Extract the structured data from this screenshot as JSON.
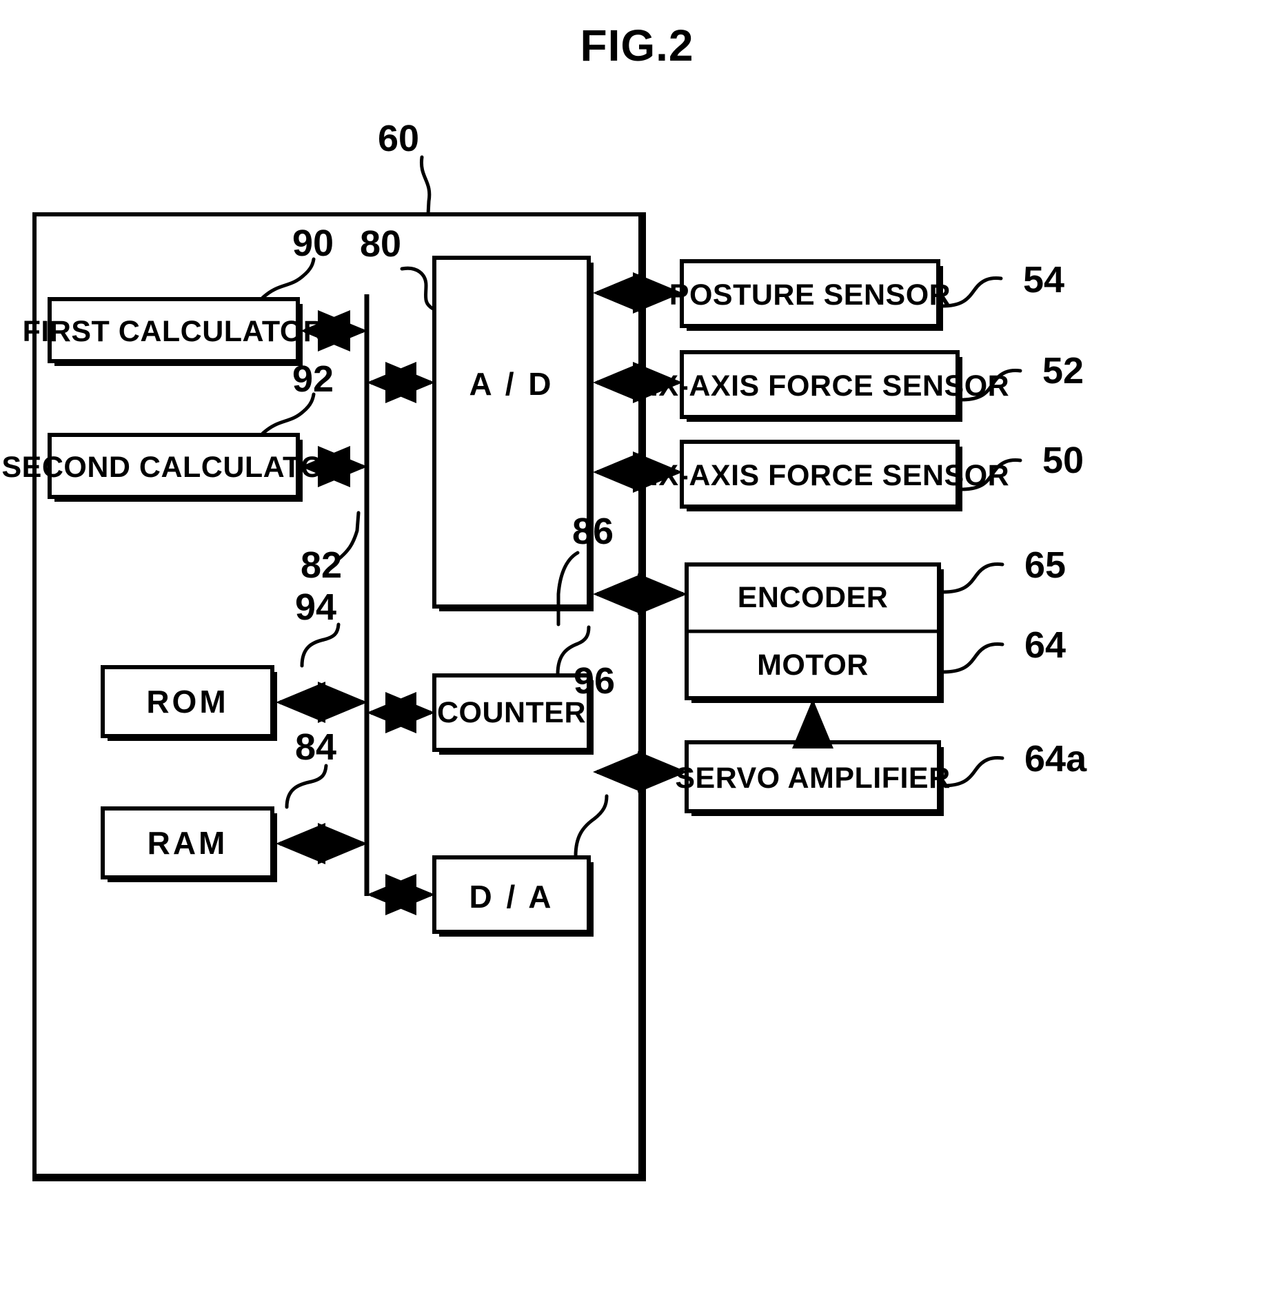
{
  "figure": {
    "title": "FIG.2",
    "system_ref": "60"
  },
  "internal_blocks": [
    {
      "id": "first-calculator",
      "label": "FIRST CALCULATOR",
      "ref": "90"
    },
    {
      "id": "second-calculator",
      "label": "SECOND CALCULATOR",
      "ref": "92"
    },
    {
      "id": "rom",
      "label": "ROM",
      "ref": "94"
    },
    {
      "id": "ram",
      "label": "RAM",
      "ref": "84"
    },
    {
      "id": "ad-converter",
      "label": "A / D",
      "ref": "80"
    },
    {
      "id": "counter",
      "label": "COUNTER",
      "ref": "86"
    },
    {
      "id": "da-converter",
      "label": "D / A",
      "ref": "96"
    }
  ],
  "bus": {
    "label": "bus",
    "ref": "82"
  },
  "external_blocks": [
    {
      "id": "posture-sensor",
      "label": "POSTURE SENSOR",
      "ref": "54"
    },
    {
      "id": "six-axis-force-sensor-52",
      "label": "SIX-AXIS FORCE SENSOR",
      "ref": "52"
    },
    {
      "id": "six-axis-force-sensor-50",
      "label": "SIX-AXIS FORCE SENSOR",
      "ref": "50"
    },
    {
      "id": "encoder",
      "label": "ENCODER",
      "ref": "65"
    },
    {
      "id": "motor",
      "label": "MOTOR",
      "ref": "64"
    },
    {
      "id": "servo-amplifier",
      "label": "SERVO AMPLIFIER",
      "ref": "64a"
    }
  ],
  "connections": [
    {
      "from": "first-calculator",
      "to": "bus",
      "type": "bidirectional"
    },
    {
      "from": "second-calculator",
      "to": "bus",
      "type": "bidirectional"
    },
    {
      "from": "rom",
      "to": "bus",
      "type": "bidirectional"
    },
    {
      "from": "ram",
      "to": "bus",
      "type": "bidirectional"
    },
    {
      "from": "bus",
      "to": "ad-converter",
      "type": "bidirectional"
    },
    {
      "from": "bus",
      "to": "counter",
      "type": "bidirectional"
    },
    {
      "from": "bus",
      "to": "da-converter",
      "type": "bidirectional"
    },
    {
      "from": "ad-converter",
      "to": "posture-sensor",
      "type": "bidirectional"
    },
    {
      "from": "ad-converter",
      "to": "six-axis-force-sensor-52",
      "type": "bidirectional"
    },
    {
      "from": "ad-converter",
      "to": "six-axis-force-sensor-50",
      "type": "bidirectional"
    },
    {
      "from": "counter",
      "to": "encoder",
      "type": "bidirectional"
    },
    {
      "from": "da-converter",
      "to": "servo-amplifier",
      "type": "bidirectional"
    },
    {
      "from": "servo-amplifier",
      "to": "motor",
      "type": "unidirectional"
    }
  ],
  "colors": {
    "ink": "#000000",
    "paper": "#ffffff"
  }
}
